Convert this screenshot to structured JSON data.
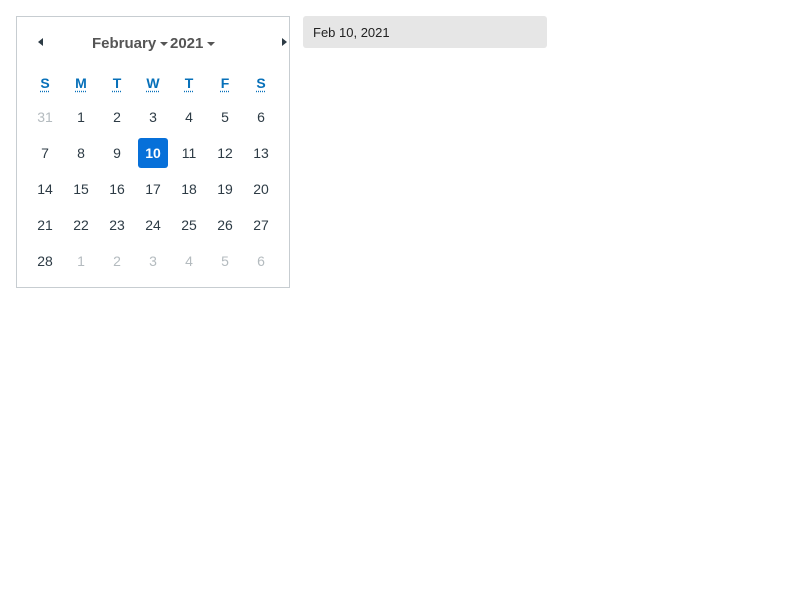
{
  "calendar": {
    "month": "February",
    "year": "2021",
    "weekdays": [
      "S",
      "M",
      "T",
      "W",
      "T",
      "F",
      "S"
    ],
    "days": [
      {
        "label": "31",
        "other": true
      },
      {
        "label": "1"
      },
      {
        "label": "2"
      },
      {
        "label": "3"
      },
      {
        "label": "4"
      },
      {
        "label": "5"
      },
      {
        "label": "6"
      },
      {
        "label": "7"
      },
      {
        "label": "8"
      },
      {
        "label": "9"
      },
      {
        "label": "10",
        "selected": true
      },
      {
        "label": "11"
      },
      {
        "label": "12"
      },
      {
        "label": "13"
      },
      {
        "label": "14"
      },
      {
        "label": "15"
      },
      {
        "label": "16"
      },
      {
        "label": "17"
      },
      {
        "label": "18"
      },
      {
        "label": "19"
      },
      {
        "label": "20"
      },
      {
        "label": "21"
      },
      {
        "label": "22"
      },
      {
        "label": "23"
      },
      {
        "label": "24"
      },
      {
        "label": "25"
      },
      {
        "label": "26"
      },
      {
        "label": "27"
      },
      {
        "label": "28"
      },
      {
        "label": "1",
        "other": true
      },
      {
        "label": "2",
        "other": true
      },
      {
        "label": "3",
        "other": true
      },
      {
        "label": "4",
        "other": true
      },
      {
        "label": "5",
        "other": true
      },
      {
        "label": "6",
        "other": true
      }
    ],
    "prev_icon": "triangle-left-icon",
    "next_icon": "triangle-right-icon"
  },
  "date_input": {
    "value": "Feb 10, 2021"
  },
  "colors": {
    "selected": "#0770d9",
    "weekday": "#0770b9",
    "muted": "#b4bbbf"
  }
}
